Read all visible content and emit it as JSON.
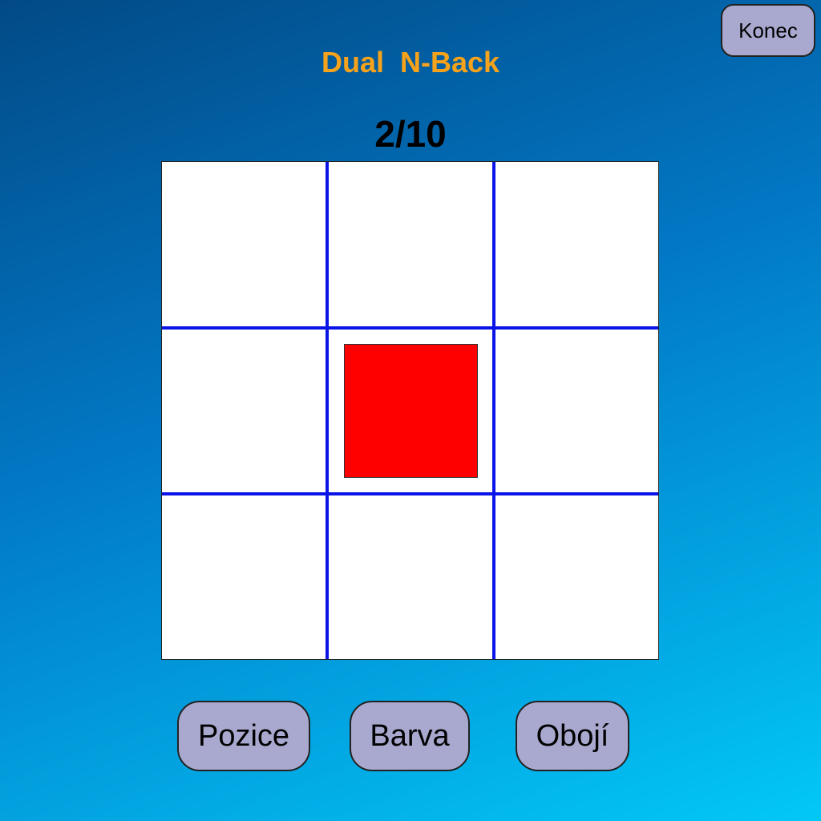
{
  "header": {
    "title": "Dual  N-Back",
    "end_button_label": "Konec"
  },
  "progress": {
    "label": "2/10",
    "current": 2,
    "total": 10
  },
  "grid": {
    "rows": 3,
    "cols": 3,
    "line_color": "#0a14e6",
    "background_color": "#ffffff",
    "active_cell": {
      "row": 1,
      "col": 1
    },
    "stimulus_color": "#ff0000"
  },
  "buttons": {
    "position_label": "Pozice",
    "color_label": "Barva",
    "both_label": "Obojí"
  },
  "colors": {
    "title": "#f7a21b",
    "button_background": "#a9a9cf",
    "background_top": "#024a86",
    "background_bottom": "#02c8f7"
  }
}
